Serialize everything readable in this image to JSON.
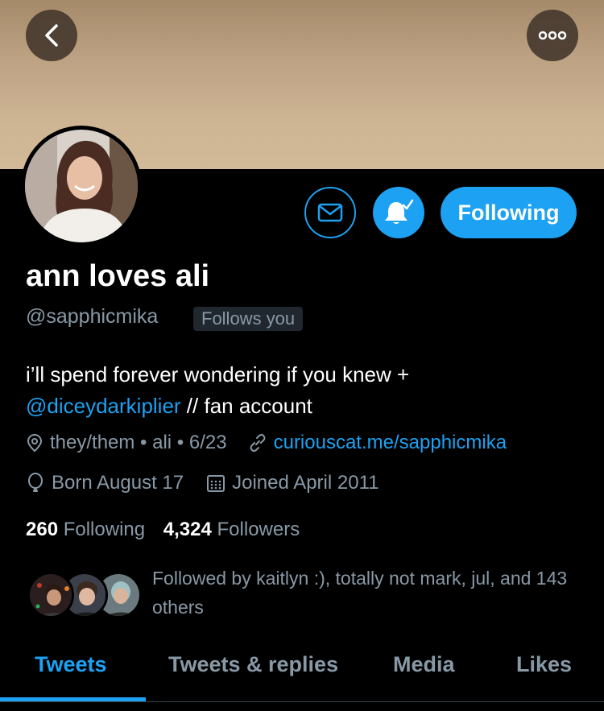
{
  "profile": {
    "display_name": "ann loves ali",
    "handle": "@sapphicmika",
    "follows_you_badge": "Follows you",
    "bio_line1": "i’ll spend forever wondering if you knew +",
    "bio_mention": "@diceydarkiplier",
    "bio_line2_rest": " // fan account",
    "location": "they/them • ali • 6/23",
    "website": "curiouscat.me/sapphicmika",
    "birthday": "Born August 17",
    "joined": "Joined April 2011"
  },
  "actions": {
    "following_label": "Following"
  },
  "stats": {
    "following_count": "260",
    "following_label": "Following",
    "followers_count": "4,324",
    "followers_label": "Followers"
  },
  "followed_by": {
    "text": "Followed by kaitlyn :), totally not mark, jul, and 143 others"
  },
  "tabs": [
    {
      "label": "Tweets",
      "active": true
    },
    {
      "label": "Tweets & replies",
      "active": false
    },
    {
      "label": "Media",
      "active": false
    },
    {
      "label": "Likes",
      "active": false
    }
  ],
  "colors": {
    "accent": "#1da1f2",
    "background": "#000000",
    "secondary_text": "#8899a6"
  },
  "icons": [
    "back-arrow-icon",
    "more-options-icon",
    "mail-icon",
    "bell-notification-icon",
    "location-pin-icon",
    "link-icon",
    "birthday-balloon-icon",
    "calendar-icon"
  ]
}
